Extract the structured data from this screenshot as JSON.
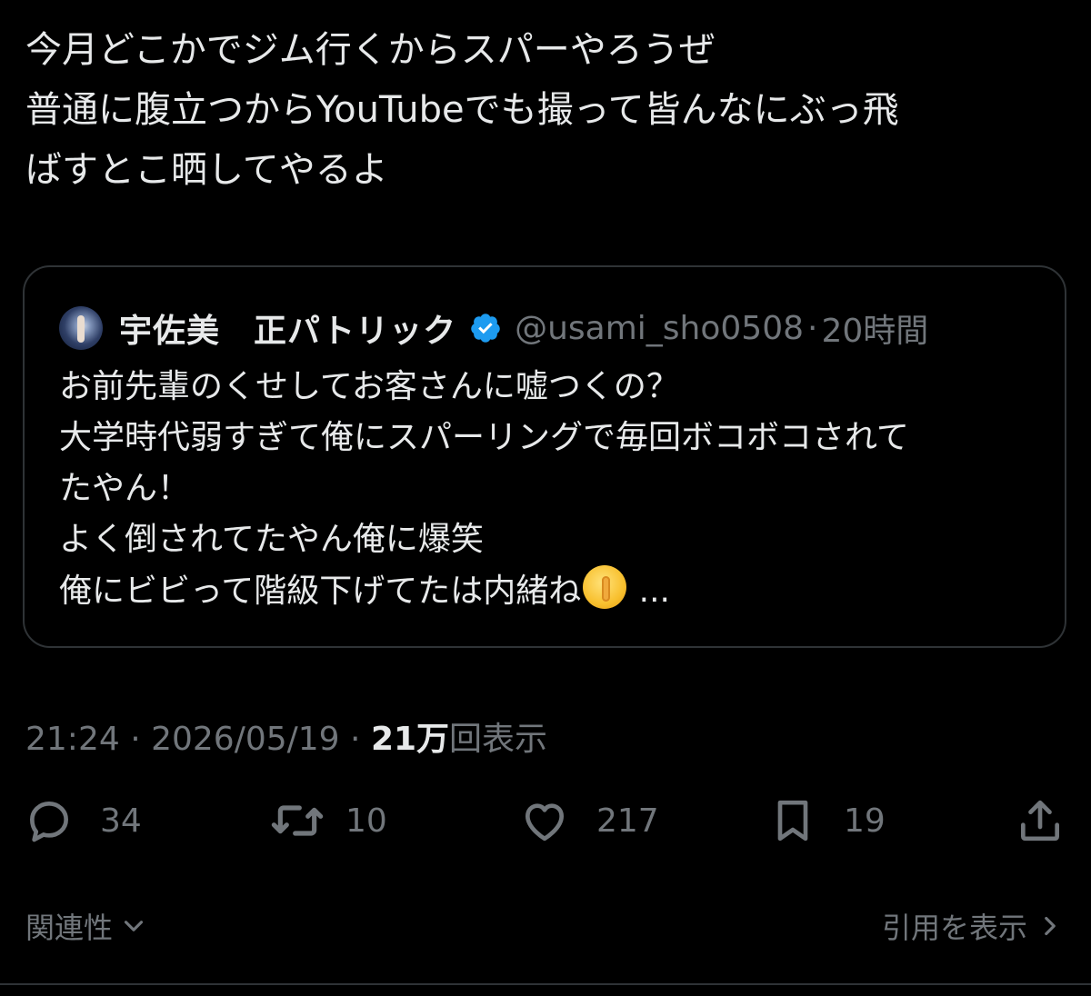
{
  "tweet": {
    "lines": [
      "今月どこかでジム行くからスパーやろうぜ",
      "普通に腹立つからYouTubeでも撮って皆んなにぶっ飛",
      "ばすとこ晒してやるよ"
    ]
  },
  "quote": {
    "name": "宇佐美　正パトリック",
    "handle": "@usami_sho0508",
    "separator": "·",
    "time": "20時間",
    "lines": [
      "お前先輩のくせしてお客さんに嘘つくの？",
      "大学時代弱すぎて俺にスパーリングで毎回ボコボコされて",
      "たやん！",
      "よく倒されてたやん俺に爆笑"
    ],
    "last_line_text": "俺にビビって階級下げてたは内緒ね",
    "last_line_ellipsis": " ...",
    "emoji_icon": "shushing-face-emoji"
  },
  "meta": {
    "time": "21:24",
    "separator": " · ",
    "date": "2026/05/19",
    "separator2": " · ",
    "views_count": "21万",
    "views_label": "回表示"
  },
  "actions": {
    "reply_count": "34",
    "retweet_count": "10",
    "like_count": "217",
    "bookmark_count": "19"
  },
  "footer": {
    "sort_label": "関連性",
    "quotes_label": "引用を表示"
  },
  "colors": {
    "background": "#000000",
    "text_primary": "#e7e9ea",
    "text_secondary": "#71767b",
    "border": "#2f3336",
    "verified_badge": "#1d9bf0"
  }
}
